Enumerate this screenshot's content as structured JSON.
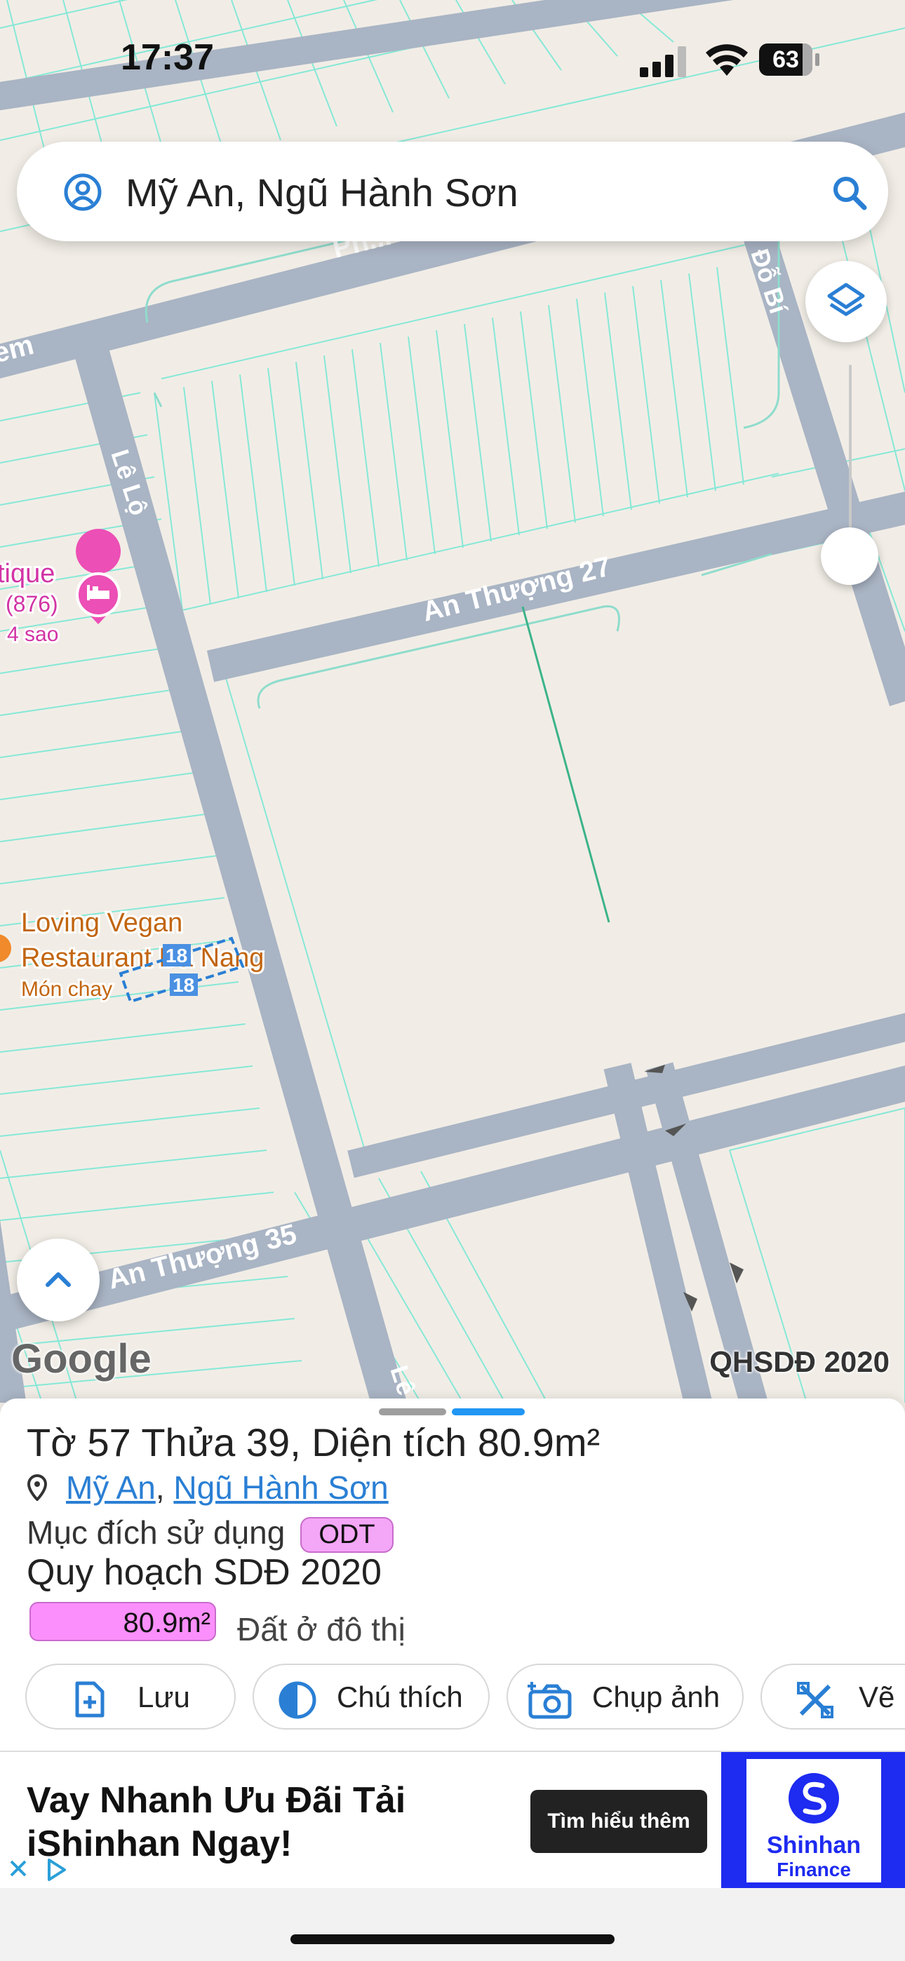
{
  "status_bar": {
    "time": "17:37",
    "battery": "63"
  },
  "search": {
    "query": "Mỹ An, Ngũ Hành Sơn"
  },
  "map": {
    "streets": {
      "pham": "Ph...",
      "em": "em",
      "le_lo": "Lê Lộ",
      "do_bi": "Đỗ Bí",
      "an_thuong_27": "An Thượng 27",
      "an_thuong_35": "An Thượng 35",
      "le_bottom": "Lê"
    },
    "poi_hotel": {
      "name": "tique",
      "reviews": "(876)",
      "stars": "4 sao"
    },
    "poi_restaurant": {
      "line1": "Loving Vegan",
      "line2": "Restaurant Da Nang",
      "category": "Món chay"
    },
    "parcel_labels": [
      "18",
      "18"
    ],
    "google": "Google",
    "layer_label": "QHSDĐ 2020"
  },
  "sheet": {
    "parcel_prefix": "Tờ ",
    "sheet_no": "57",
    "parcel_mid": " Thửa ",
    "parcel_no": "39",
    "area_prefix": ", Diện tích ",
    "area": "80.9m²",
    "ward": "Mỹ An",
    "district": "Ngũ Hành Sơn",
    "purpose_label": "Mục đích sử dụng",
    "purpose_code": "ODT",
    "plan_title": "Quy hoạch SDĐ 2020",
    "plan_area": "80.9m²",
    "plan_land_type": "Đất ở đô thị"
  },
  "actions": {
    "save": "Lưu",
    "legend": "Chú thích",
    "photo": "Chụp ảnh",
    "draw": "Vẽ"
  },
  "ad": {
    "line1": "Vay Nhanh Ưu Đãi Tải",
    "line2": "iShinhan Ngay!",
    "cta": "Tìm hiểu thêm",
    "brand": "Shinhan",
    "brand_sub": "Finance"
  },
  "colors": {
    "accent": "#2196f3",
    "road": "#a9b4c4",
    "parcel_line": "#7ee6d6",
    "map_bg": "#f1ede6",
    "odt": "#f4a6f7"
  }
}
